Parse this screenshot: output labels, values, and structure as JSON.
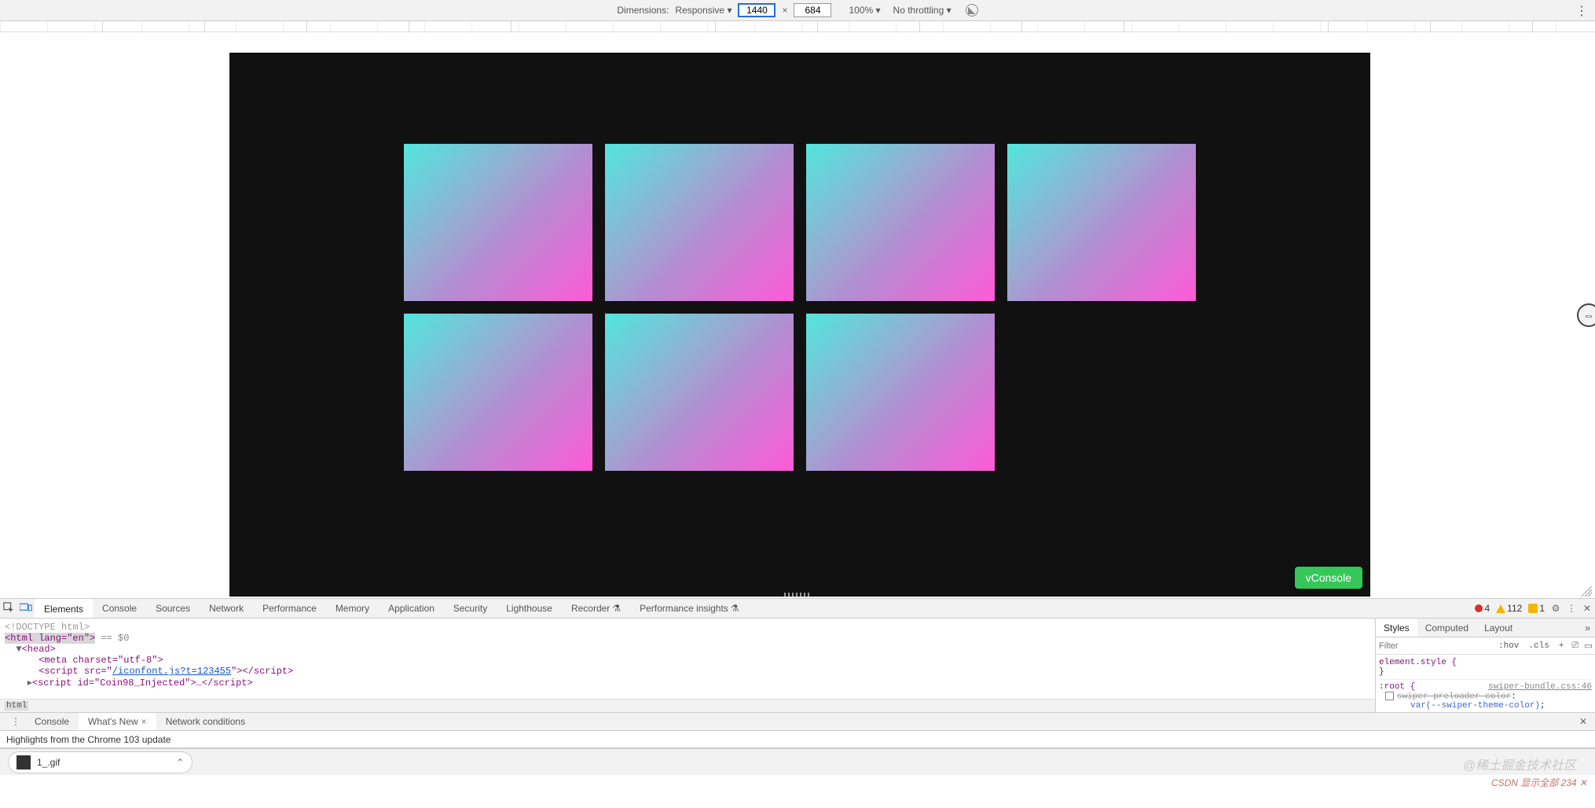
{
  "device_toolbar": {
    "dimensions_label": "Dimensions:",
    "device_preset": "Responsive",
    "width": "1440",
    "height": "684",
    "zoom": "100%",
    "throttling": "No throttling"
  },
  "preview": {
    "vconsole_label": "vConsole",
    "tile_count": 7
  },
  "devtools_tabs": {
    "items": [
      "Elements",
      "Console",
      "Sources",
      "Network",
      "Performance",
      "Memory",
      "Application",
      "Security",
      "Lighthouse",
      "Recorder",
      "Performance insights"
    ],
    "active": "Elements",
    "experiment_flag_tabs": [
      "Recorder",
      "Performance insights"
    ],
    "errors": "4",
    "warnings": "112",
    "issues": "1"
  },
  "elements_panel": {
    "doctype": "<!DOCTYPE html>",
    "html_open": "<html lang=\"en\">",
    "eq_suffix": " == $0",
    "head_open": "<head>",
    "meta_line": "<meta charset=\"utf-8\">",
    "script1_prefix": "<script src=\"",
    "script1_link": "/iconfont.js?t=123455",
    "script1_suffix": "\"></script>",
    "script2": "<script id=\"Coin98_Injected\">…</script>",
    "breadcrumb": "html"
  },
  "styles_panel": {
    "tabs": [
      "Styles",
      "Computed",
      "Layout"
    ],
    "filter_placeholder": "Filter",
    "chips": [
      ":hov",
      ".cls",
      "+"
    ],
    "element_style_selector": "element.style {",
    "close_brace": "}",
    "root_selector": ":root {",
    "root_source": "swiper-bundle.css:46",
    "prop_strike": "swiper-preloader-color",
    "prop_var": "var(--swiper-theme-color)"
  },
  "drawer": {
    "tabs": [
      "Console",
      "What's New",
      "Network conditions"
    ],
    "active": "What's New",
    "body": "Highlights from the Chrome 103 update"
  },
  "download": {
    "filename": "1_.gif"
  },
  "watermarks": {
    "w1": "@稀土掘金技术社区",
    "w2": "CSDN 显示全部 234 ✕"
  }
}
